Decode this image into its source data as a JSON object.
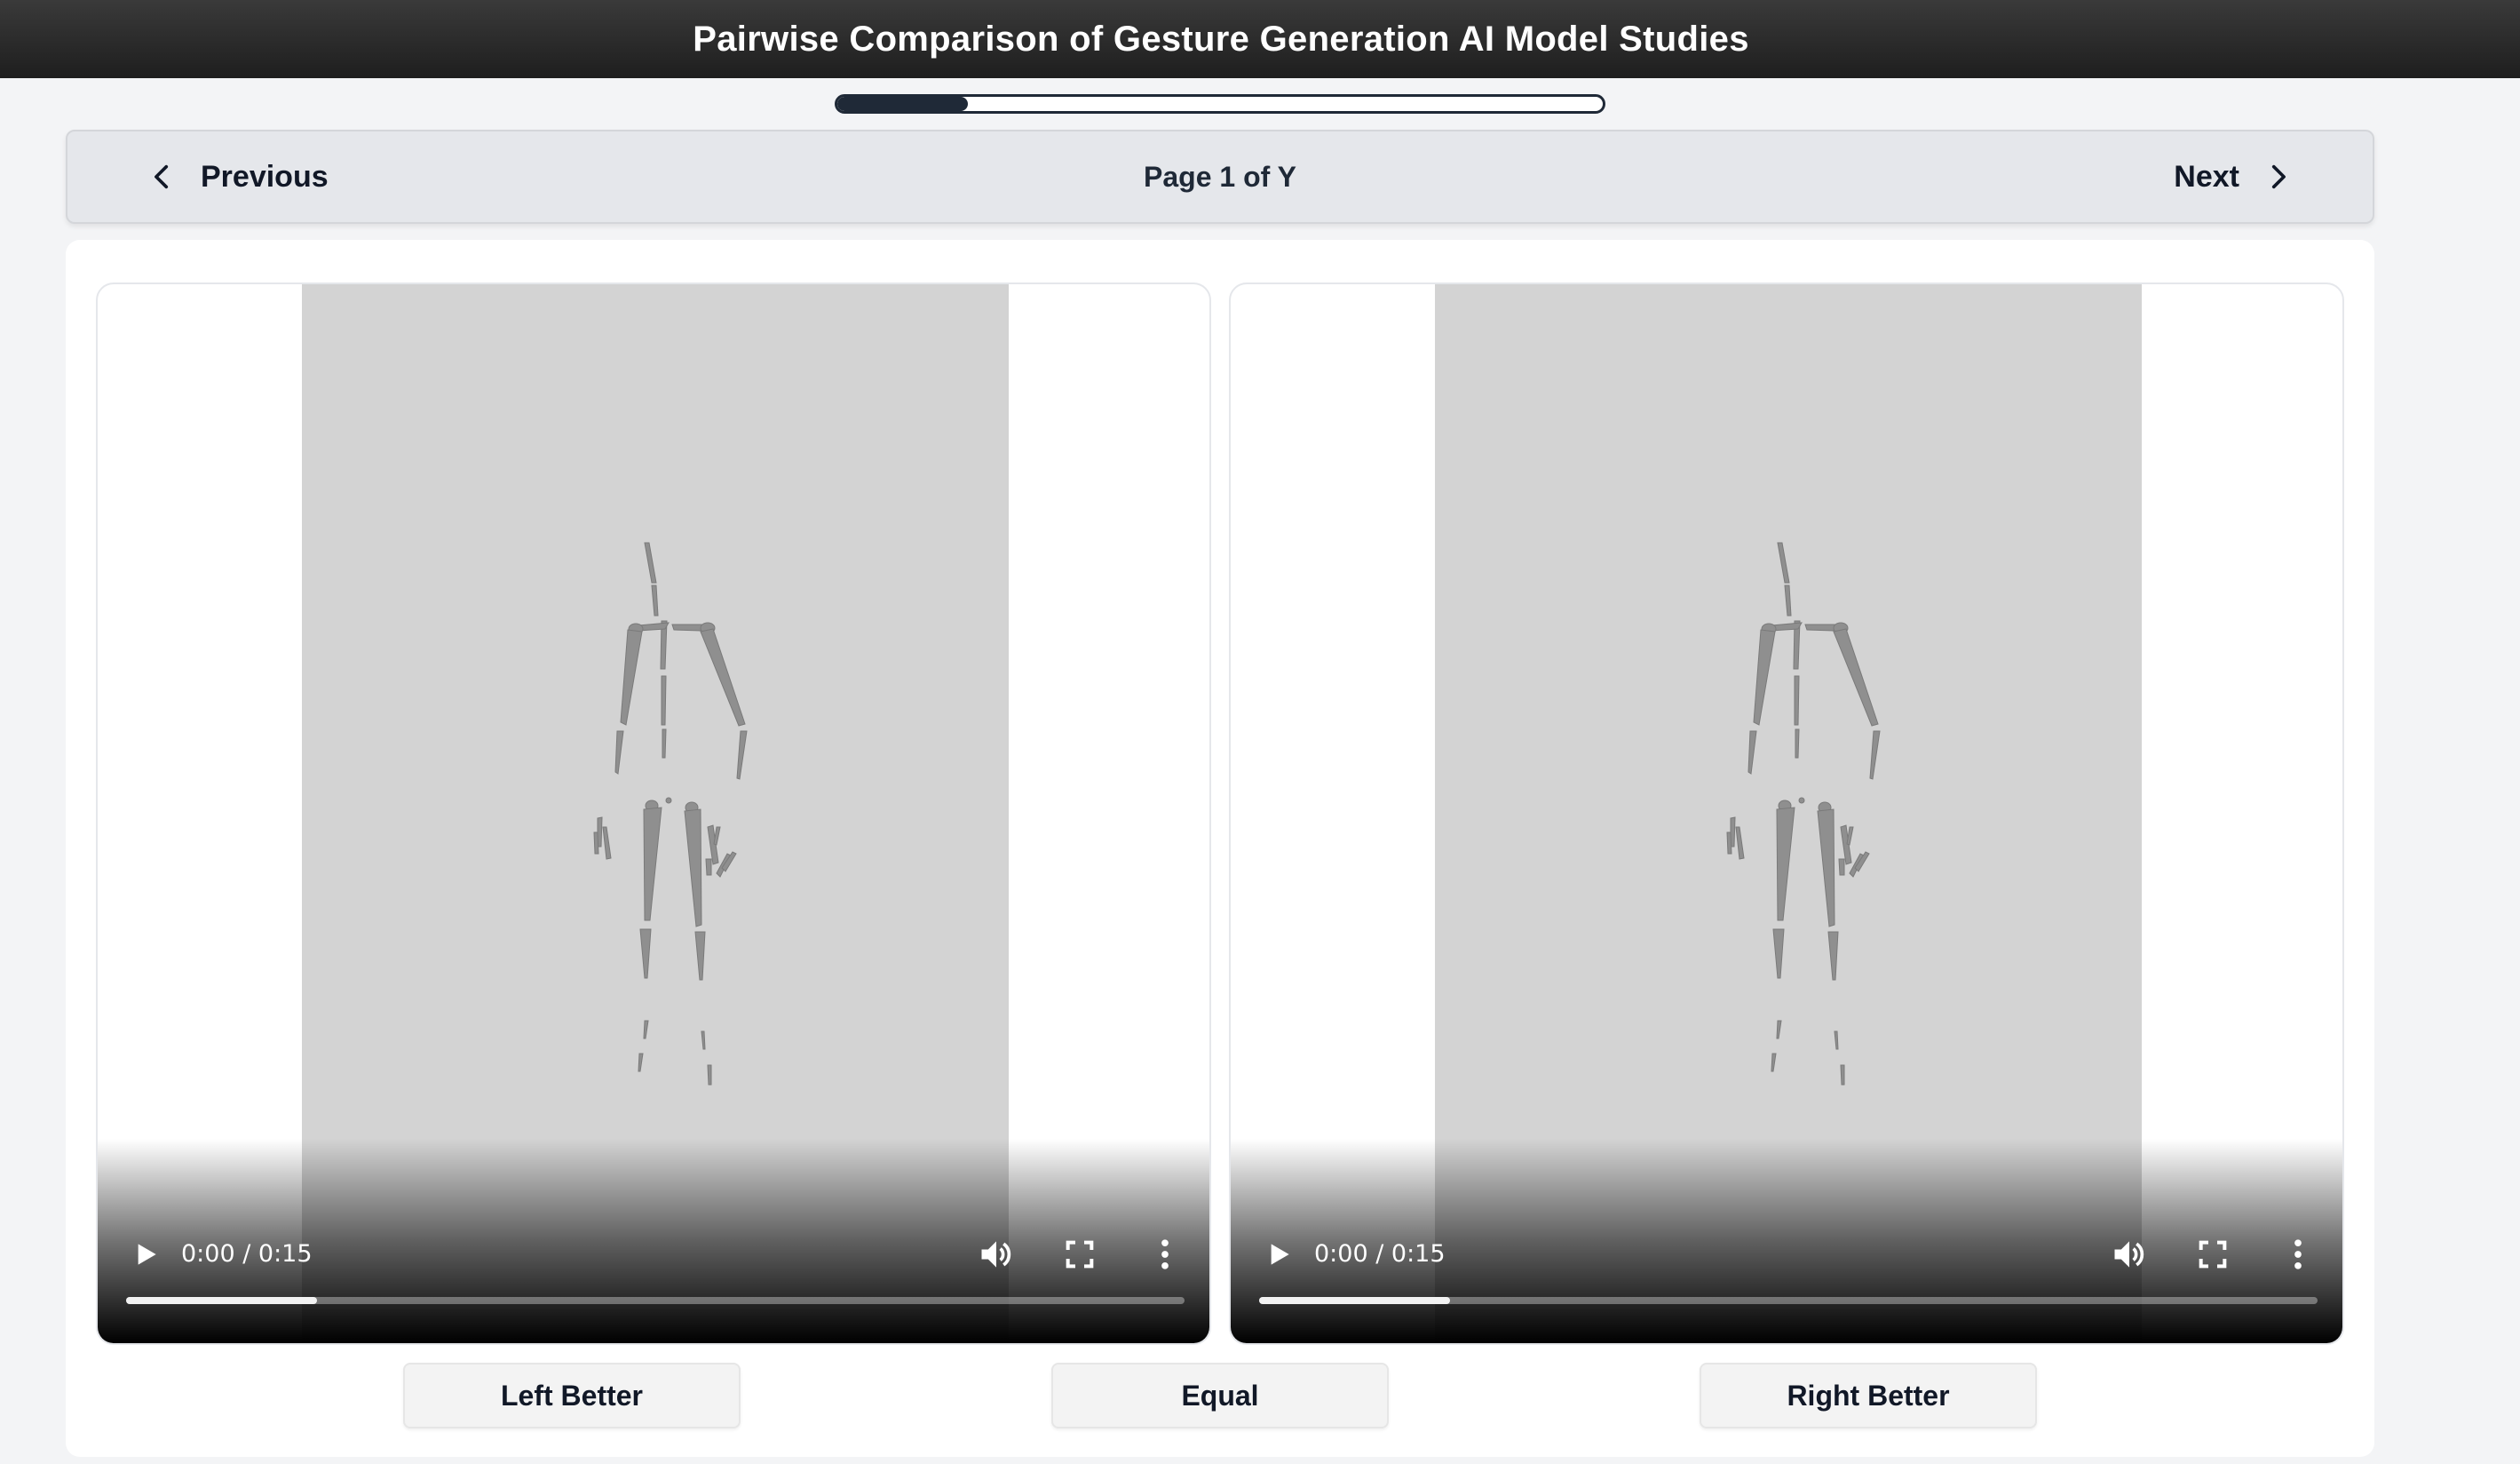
{
  "header": {
    "title": "Pairwise Comparison of Gesture Generation AI Model Studies"
  },
  "progress": {
    "fraction": 0.17
  },
  "nav": {
    "previous_label": "Previous",
    "page_label": "Page 1 of Y",
    "next_label": "Next"
  },
  "videos": {
    "left": {
      "time": "0:00 / 0:15",
      "buffered_fraction": 0.18
    },
    "right": {
      "time": "0:00 / 0:15",
      "buffered_fraction": 0.18
    }
  },
  "choices": {
    "left_label": "Left Better",
    "equal_label": "Equal",
    "right_label": "Right Better"
  },
  "icons": {
    "previous": "chevron-left-icon",
    "next": "chevron-right-icon",
    "play": "play-icon",
    "volume": "volume-icon",
    "fullscreen": "fullscreen-icon",
    "more": "more-vertical-icon"
  },
  "colors": {
    "header_background": "#232323",
    "progress_fill": "#1f2937",
    "video_background": "#d3d3d3",
    "skeleton": "#8f8f8f"
  }
}
